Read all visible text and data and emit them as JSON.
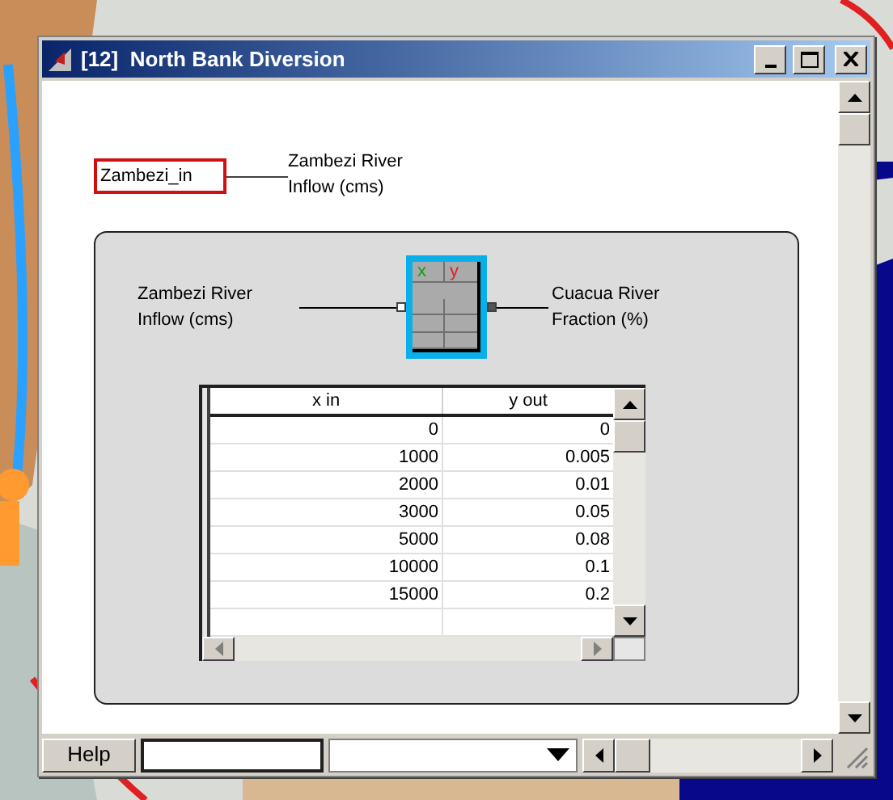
{
  "window": {
    "title": "[12]  North Bank Diversion"
  },
  "source": {
    "name": "Zambezi_in",
    "description": [
      "Zambezi River",
      "Inflow (cms)"
    ]
  },
  "block": {
    "input": [
      "Zambezi River",
      "Inflow (cms)"
    ],
    "output": [
      "Cuacua River",
      "Fraction (%)"
    ],
    "icon_headers": [
      "x",
      "y"
    ]
  },
  "table": {
    "columns": [
      "x in",
      "y out"
    ],
    "rows": [
      [
        "0",
        "0"
      ],
      [
        "1000",
        "0.005"
      ],
      [
        "2000",
        "0.01"
      ],
      [
        "3000",
        "0.05"
      ],
      [
        "5000",
        "0.08"
      ],
      [
        "10000",
        "0.1"
      ],
      [
        "15000",
        "0.2"
      ],
      [
        "",
        ""
      ]
    ]
  },
  "bottom_bar": {
    "help": "Help"
  }
}
